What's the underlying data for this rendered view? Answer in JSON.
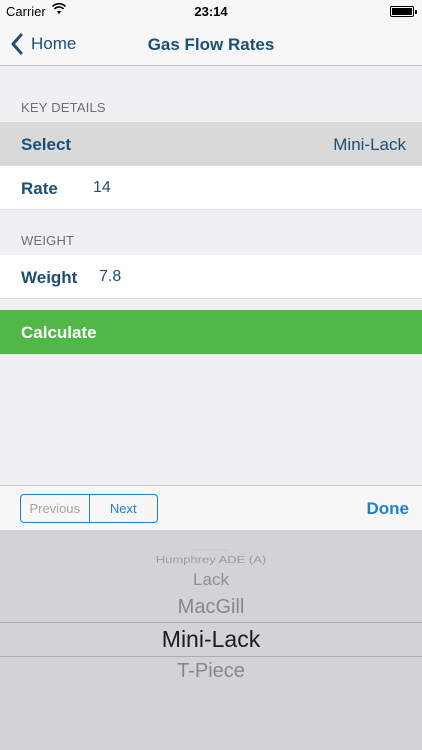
{
  "status_bar": {
    "carrier": "Carrier",
    "time": "23:14"
  },
  "nav": {
    "back_label": "Home",
    "title": "Gas Flow Rates"
  },
  "key_details": {
    "header": "KEY DETAILS",
    "select_label": "Select",
    "select_value": "Mini-Lack",
    "rate_label": "Rate",
    "rate_value": "14"
  },
  "weight_section": {
    "header": "WEIGHT",
    "weight_label": "Weight",
    "weight_value": "7.8"
  },
  "calculate_label": "Calculate",
  "toolbar": {
    "previous_label": "Previous",
    "next_label": "Next",
    "done_label": "Done"
  },
  "picker": {
    "items": [
      "Humphrey ADE (A)",
      "Lack",
      "MacGill",
      "Mini-Lack",
      "T-Piece"
    ],
    "selected": "Mini-Lack"
  },
  "colors": {
    "accent": "#1d4f76",
    "link": "#1d7ed4",
    "calculate": "#51b848"
  }
}
